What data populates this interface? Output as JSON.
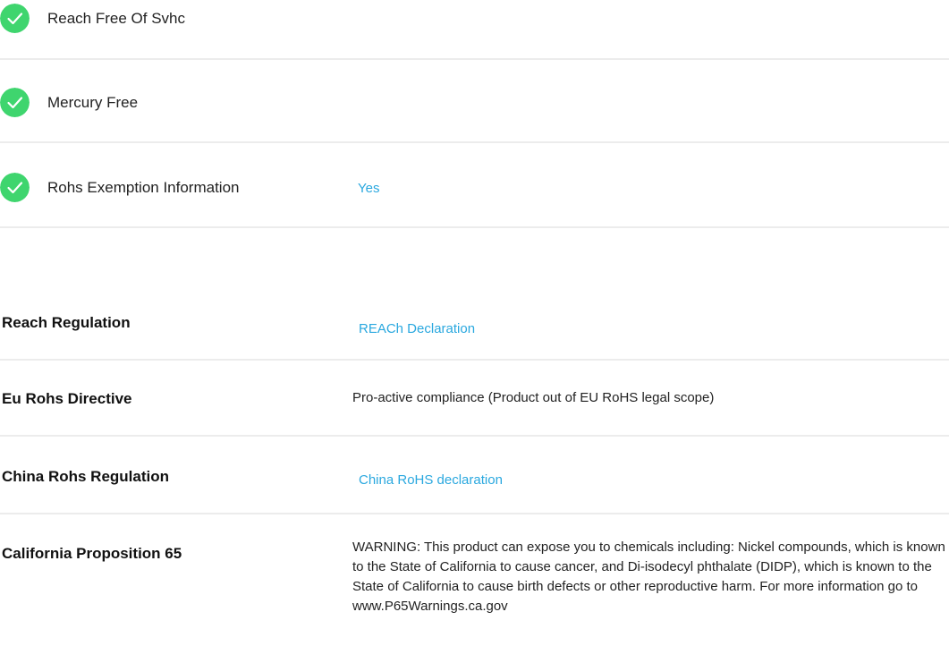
{
  "compliance_checks": [
    {
      "label": "Reach Free Of Svhc",
      "value": "",
      "icon": "check-circle-icon"
    },
    {
      "label": "Mercury Free",
      "value": "",
      "icon": "check-circle-icon"
    },
    {
      "label": "Rohs Exemption Information",
      "value": "Yes",
      "icon": "check-circle-icon"
    }
  ],
  "regulations": [
    {
      "label": "Reach Regulation",
      "value": "REACh Declaration",
      "is_link": true
    },
    {
      "label": "Eu Rohs Directive",
      "value": "Pro-active compliance (Product out of EU RoHS legal scope)",
      "is_link": false
    },
    {
      "label": "China Rohs Regulation",
      "value": "China RoHS declaration",
      "is_link": true
    },
    {
      "label": "California Proposition 65",
      "value": "WARNING: This product can expose you to chemicals including: Nickel compounds, which is known to the State of California to cause cancer, and Di-isodecyl phthalate (DIDP), which is known to the State of California to cause birth defects or other reproductive harm. For more information go to www.P65Warnings.ca.gov",
      "is_link": false
    }
  ],
  "colors": {
    "check_green": "#3fd56e",
    "link_blue": "#2aa8df",
    "divider": "#ececec"
  }
}
